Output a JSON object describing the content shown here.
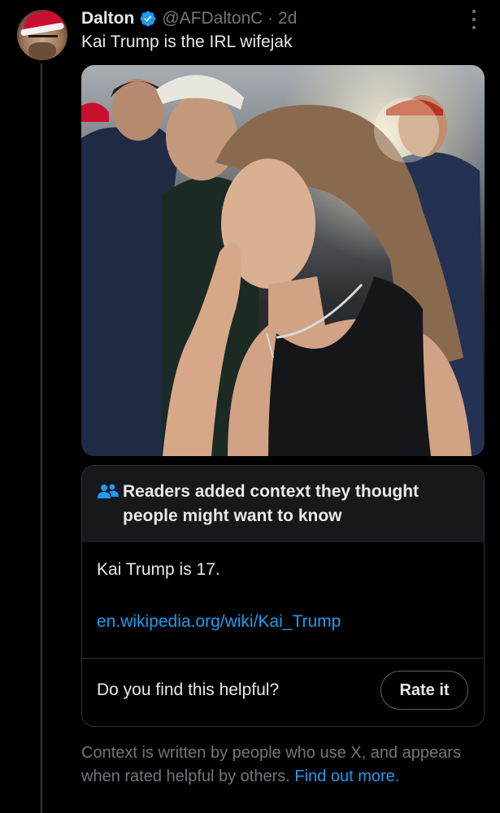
{
  "tweet": {
    "author_name": "Dalton",
    "handle_time": "@AFDaltonC · 2d",
    "text": "Kai Trump is the IRL wifejak"
  },
  "community_note": {
    "title": "Readers added context they thought people might want to know",
    "body": "Kai Trump is 17.",
    "link": "en.wikipedia.org/wiki/Kai_Trump",
    "helpful_question": "Do you find this helpful?",
    "rate_button": "Rate it"
  },
  "footer": {
    "text": "Context is written by people who use X, and appears when rated helpful by others.",
    "link": "Find out more."
  },
  "colors": {
    "background": "#000000",
    "text": "#e7e9ea",
    "secondary_text": "#71767b",
    "link": "#1d9bf0",
    "verified_badge": "#1d9bf0",
    "note_header_bg": "#16181c"
  },
  "icons": [
    "verified-badge-icon",
    "more-options-icon",
    "people-icon"
  ]
}
